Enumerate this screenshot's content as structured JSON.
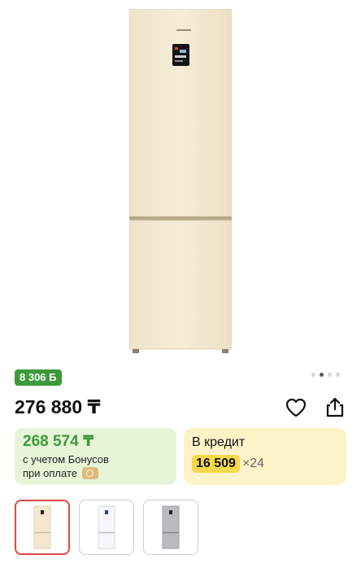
{
  "product": {
    "bonus_badge": "8 306 Б",
    "price": "276 880 ₸"
  },
  "gallery": {
    "dots_count": 4,
    "active_index": 1
  },
  "bonus_card": {
    "price": "268 574 ₸",
    "line1": "с учетом Бонусов",
    "line2": "при оплате"
  },
  "credit_card": {
    "title": "В кредит",
    "amount": "16 509",
    "months": "×24"
  },
  "thumbnails": [
    {
      "color": "beige",
      "selected": true
    },
    {
      "color": "white",
      "selected": false
    },
    {
      "color": "silver",
      "selected": false
    }
  ],
  "colors": {
    "accent_green": "#3c9a3a",
    "bonus_bg": "#e6f5d8",
    "credit_bg": "#fdf3c8",
    "credit_highlight": "#f7d84a",
    "selected_border": "#e0473f"
  }
}
